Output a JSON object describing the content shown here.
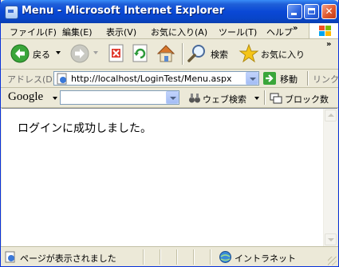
{
  "window": {
    "title": "Menu - Microsoft Internet Explorer"
  },
  "menu": {
    "items": [
      "ファイル(F)",
      "編集(E)",
      "表示(V)",
      "お気に入り(A)",
      "ツール(T)",
      "ヘルプ"
    ],
    "overflow": "»"
  },
  "toolbar": {
    "back_label": "戻る",
    "search_label": "検索",
    "favorites_label": "お気に入り",
    "overflow": "»"
  },
  "address": {
    "label": "アドレス(D)",
    "url": "http://localhost/LoginTest/Menu.aspx",
    "go_label": "移動",
    "links_label": "リンク"
  },
  "google": {
    "logo": "Google",
    "search_value": "",
    "web_search_label": "ウェブ検索",
    "popup_block_label": "ブロック数"
  },
  "content": {
    "message": "ログインに成功しました。"
  },
  "status": {
    "text": "ページが表示されました",
    "zone": "イントラネット"
  },
  "colors": {
    "titlebar": "#0a48d6",
    "chrome": "#ece9d8",
    "close": "#e0582e"
  }
}
